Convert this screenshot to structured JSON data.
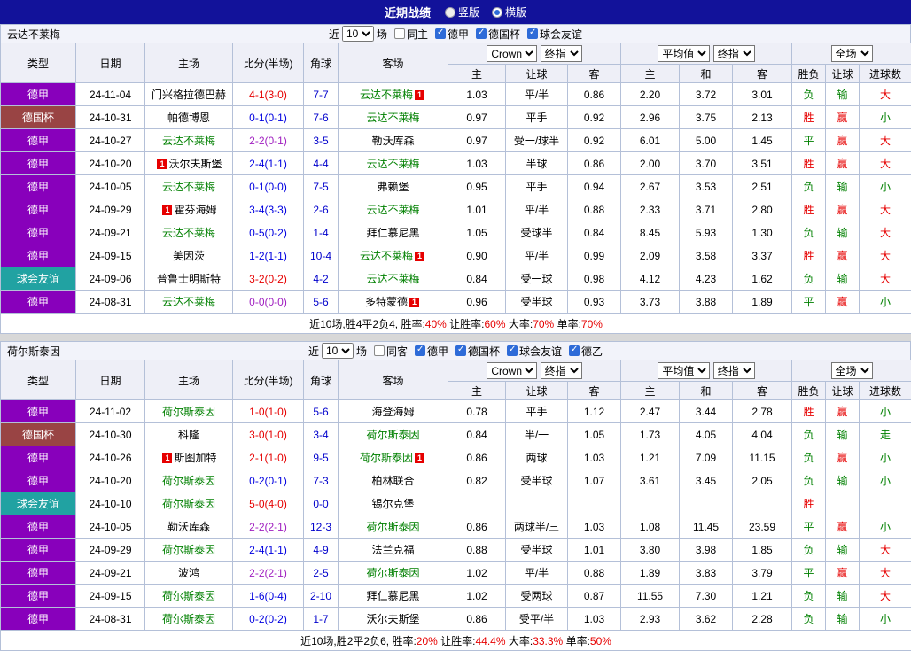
{
  "topbar": {
    "title": "近期战绩",
    "layout_options": [
      {
        "label": "竖版",
        "selected": false
      },
      {
        "label": "横版",
        "selected": true
      }
    ]
  },
  "table_header": {
    "cols": [
      "类型",
      "日期",
      "主场",
      "比分(半场)",
      "角球",
      "客场"
    ],
    "bookmaker_select": "Crown",
    "final_select": "终指",
    "average_select": "平均值",
    "scope_select": "全场",
    "handicap_cols": [
      "主",
      "让球",
      "客"
    ],
    "average_cols": [
      "主",
      "和",
      "客"
    ],
    "result_cols": [
      "胜负",
      "让球",
      "进球数"
    ]
  },
  "sections": [
    {
      "team": "云达不莱梅",
      "filters": {
        "near_label": "近",
        "count": "10",
        "games_label": "场",
        "checkboxes": [
          {
            "label": "同主",
            "checked": false
          },
          {
            "label": "德甲",
            "checked": true
          },
          {
            "label": "德国杯",
            "checked": true
          },
          {
            "label": "球会友谊",
            "checked": true
          }
        ]
      },
      "rows": [
        {
          "league": "德甲",
          "date": "24-11-04",
          "home": "门兴格拉德巴赫",
          "home_focus": false,
          "home_card": false,
          "away": "云达不莱梅",
          "away_focus": true,
          "away_card": true,
          "score": "4-1(3-0)",
          "score_result": "home_win",
          "corners": "7-7",
          "odds": [
            "1.03",
            "平/半",
            "0.86",
            "2.20",
            "3.72",
            "3.01"
          ],
          "results": [
            "负",
            "输",
            "大"
          ]
        },
        {
          "league": "德国杯",
          "date": "24-10-31",
          "home": "帕德博恩",
          "home_focus": false,
          "home_card": false,
          "away": "云达不莱梅",
          "away_focus": true,
          "away_card": false,
          "score": "0-1(0-1)",
          "score_result": "away_win",
          "corners": "7-6",
          "odds": [
            "0.97",
            "平手",
            "0.92",
            "2.96",
            "3.75",
            "2.13"
          ],
          "results": [
            "胜",
            "赢",
            "小"
          ]
        },
        {
          "league": "德甲",
          "date": "24-10-27",
          "home": "云达不莱梅",
          "home_focus": true,
          "home_card": false,
          "away": "勒沃库森",
          "away_focus": false,
          "away_card": false,
          "score": "2-2(0-1)",
          "score_result": "draw",
          "corners": "3-5",
          "odds": [
            "0.97",
            "受一/球半",
            "0.92",
            "6.01",
            "5.00",
            "1.45"
          ],
          "results": [
            "平",
            "赢",
            "大"
          ]
        },
        {
          "league": "德甲",
          "date": "24-10-20",
          "home": "沃尔夫斯堡",
          "home_focus": false,
          "home_card": true,
          "away": "云达不莱梅",
          "away_focus": true,
          "away_card": false,
          "score": "2-4(1-1)",
          "score_result": "away_win",
          "corners": "4-4",
          "odds": [
            "1.03",
            "半球",
            "0.86",
            "2.00",
            "3.70",
            "3.51"
          ],
          "results": [
            "胜",
            "赢",
            "大"
          ]
        },
        {
          "league": "德甲",
          "date": "24-10-05",
          "home": "云达不莱梅",
          "home_focus": true,
          "home_card": false,
          "away": "弗赖堡",
          "away_focus": false,
          "away_card": false,
          "score": "0-1(0-0)",
          "score_result": "away_win",
          "corners": "7-5",
          "odds": [
            "0.95",
            "平手",
            "0.94",
            "2.67",
            "3.53",
            "2.51"
          ],
          "results": [
            "负",
            "输",
            "小"
          ]
        },
        {
          "league": "德甲",
          "date": "24-09-29",
          "home": "霍芬海姆",
          "home_focus": false,
          "home_card": true,
          "away": "云达不莱梅",
          "away_focus": true,
          "away_card": false,
          "score": "3-4(3-3)",
          "score_result": "away_win",
          "corners": "2-6",
          "odds": [
            "1.01",
            "平/半",
            "0.88",
            "2.33",
            "3.71",
            "2.80"
          ],
          "results": [
            "胜",
            "赢",
            "大"
          ]
        },
        {
          "league": "德甲",
          "date": "24-09-21",
          "home": "云达不莱梅",
          "home_focus": true,
          "home_card": false,
          "away": "拜仁慕尼黑",
          "away_focus": false,
          "away_card": false,
          "score": "0-5(0-2)",
          "score_result": "away_win",
          "corners": "1-4",
          "odds": [
            "1.05",
            "受球半",
            "0.84",
            "8.45",
            "5.93",
            "1.30"
          ],
          "results": [
            "负",
            "输",
            "大"
          ]
        },
        {
          "league": "德甲",
          "date": "24-09-15",
          "home": "美因茨",
          "home_focus": false,
          "home_card": false,
          "away": "云达不莱梅",
          "away_focus": true,
          "away_card": true,
          "score": "1-2(1-1)",
          "score_result": "away_win",
          "corners": "10-4",
          "odds": [
            "0.90",
            "平/半",
            "0.99",
            "2.09",
            "3.58",
            "3.37"
          ],
          "results": [
            "胜",
            "赢",
            "大"
          ]
        },
        {
          "league": "球会友谊",
          "date": "24-09-06",
          "home": "普鲁士明斯特",
          "home_focus": false,
          "home_card": false,
          "away": "云达不莱梅",
          "away_focus": true,
          "away_card": false,
          "score": "3-2(0-2)",
          "score_result": "home_win",
          "corners": "4-2",
          "odds": [
            "0.84",
            "受一球",
            "0.98",
            "4.12",
            "4.23",
            "1.62"
          ],
          "results": [
            "负",
            "输",
            "大"
          ]
        },
        {
          "league": "德甲",
          "date": "24-08-31",
          "home": "云达不莱梅",
          "home_focus": true,
          "home_card": false,
          "away": "多特蒙德",
          "away_focus": false,
          "away_card": true,
          "score": "0-0(0-0)",
          "score_result": "draw",
          "corners": "5-6",
          "odds": [
            "0.96",
            "受半球",
            "0.93",
            "3.73",
            "3.88",
            "1.89"
          ],
          "results": [
            "平",
            "赢",
            "小"
          ]
        }
      ],
      "summary": [
        {
          "text": "近10场,胜4平2负4, 胜率:",
          "highlight": false
        },
        {
          "text": "40%",
          "highlight": true
        },
        {
          "text": " 让胜率:",
          "highlight": false
        },
        {
          "text": "60%",
          "highlight": true
        },
        {
          "text": " 大率:",
          "highlight": false
        },
        {
          "text": "70%",
          "highlight": true
        },
        {
          "text": " 单率:",
          "highlight": false
        },
        {
          "text": "70%",
          "highlight": true
        }
      ]
    },
    {
      "team": "荷尔斯泰因",
      "filters": {
        "near_label": "近",
        "count": "10",
        "games_label": "场",
        "checkboxes": [
          {
            "label": "同客",
            "checked": false
          },
          {
            "label": "德甲",
            "checked": true
          },
          {
            "label": "德国杯",
            "checked": true
          },
          {
            "label": "球会友谊",
            "checked": true
          },
          {
            "label": "德乙",
            "checked": true
          }
        ]
      },
      "rows": [
        {
          "league": "德甲",
          "date": "24-11-02",
          "home": "荷尔斯泰因",
          "home_focus": true,
          "home_card": false,
          "away": "海登海姆",
          "away_focus": false,
          "away_card": false,
          "score": "1-0(1-0)",
          "score_result": "home_win",
          "corners": "5-6",
          "odds": [
            "0.78",
            "平手",
            "1.12",
            "2.47",
            "3.44",
            "2.78"
          ],
          "results": [
            "胜",
            "赢",
            "小"
          ]
        },
        {
          "league": "德国杯",
          "date": "24-10-30",
          "home": "科隆",
          "home_focus": false,
          "home_card": false,
          "away": "荷尔斯泰因",
          "away_focus": true,
          "away_card": false,
          "score": "3-0(1-0)",
          "score_result": "home_win",
          "corners": "3-4",
          "odds": [
            "0.84",
            "半/一",
            "1.05",
            "1.73",
            "4.05",
            "4.04"
          ],
          "results": [
            "负",
            "输",
            "走"
          ]
        },
        {
          "league": "德甲",
          "date": "24-10-26",
          "home": "斯图加特",
          "home_focus": false,
          "home_card": true,
          "away": "荷尔斯泰因",
          "away_focus": true,
          "away_card": true,
          "score": "2-1(1-0)",
          "score_result": "home_win",
          "corners": "9-5",
          "odds": [
            "0.86",
            "两球",
            "1.03",
            "1.21",
            "7.09",
            "11.15"
          ],
          "results": [
            "负",
            "赢",
            "小"
          ]
        },
        {
          "league": "德甲",
          "date": "24-10-20",
          "home": "荷尔斯泰因",
          "home_focus": true,
          "home_card": false,
          "away": "柏林联合",
          "away_focus": false,
          "away_card": false,
          "score": "0-2(0-1)",
          "score_result": "away_win",
          "corners": "7-3",
          "odds": [
            "0.82",
            "受半球",
            "1.07",
            "3.61",
            "3.45",
            "2.05"
          ],
          "results": [
            "负",
            "输",
            "小"
          ]
        },
        {
          "league": "球会友谊",
          "date": "24-10-10",
          "home": "荷尔斯泰因",
          "home_focus": true,
          "home_card": false,
          "away": "锡尔克堡",
          "away_focus": false,
          "away_card": false,
          "score": "5-0(4-0)",
          "score_result": "home_win",
          "corners": "0-0",
          "odds": [
            "",
            "",
            "",
            "",
            "",
            ""
          ],
          "results": [
            "胜",
            "",
            ""
          ]
        },
        {
          "league": "德甲",
          "date": "24-10-05",
          "home": "勒沃库森",
          "home_focus": false,
          "home_card": false,
          "away": "荷尔斯泰因",
          "away_focus": true,
          "away_card": false,
          "score": "2-2(2-1)",
          "score_result": "draw",
          "corners": "12-3",
          "odds": [
            "0.86",
            "两球半/三",
            "1.03",
            "1.08",
            "11.45",
            "23.59"
          ],
          "results": [
            "平",
            "赢",
            "小"
          ]
        },
        {
          "league": "德甲",
          "date": "24-09-29",
          "home": "荷尔斯泰因",
          "home_focus": true,
          "home_card": false,
          "away": "法兰克福",
          "away_focus": false,
          "away_card": false,
          "score": "2-4(1-1)",
          "score_result": "away_win",
          "corners": "4-9",
          "odds": [
            "0.88",
            "受半球",
            "1.01",
            "3.80",
            "3.98",
            "1.85"
          ],
          "results": [
            "负",
            "输",
            "大"
          ]
        },
        {
          "league": "德甲",
          "date": "24-09-21",
          "home": "波鸿",
          "home_focus": false,
          "home_card": false,
          "away": "荷尔斯泰因",
          "away_focus": true,
          "away_card": false,
          "score": "2-2(2-1)",
          "score_result": "draw",
          "corners": "2-5",
          "odds": [
            "1.02",
            "平/半",
            "0.88",
            "1.89",
            "3.83",
            "3.79"
          ],
          "results": [
            "平",
            "赢",
            "大"
          ]
        },
        {
          "league": "德甲",
          "date": "24-09-15",
          "home": "荷尔斯泰因",
          "home_focus": true,
          "home_card": false,
          "away": "拜仁慕尼黑",
          "away_focus": false,
          "away_card": false,
          "score": "1-6(0-4)",
          "score_result": "away_win",
          "corners": "2-10",
          "odds": [
            "1.02",
            "受两球",
            "0.87",
            "11.55",
            "7.30",
            "1.21"
          ],
          "results": [
            "负",
            "输",
            "大"
          ]
        },
        {
          "league": "德甲",
          "date": "24-08-31",
          "home": "荷尔斯泰因",
          "home_focus": true,
          "home_card": false,
          "away": "沃尔夫斯堡",
          "away_focus": false,
          "away_card": false,
          "score": "0-2(0-2)",
          "score_result": "away_win",
          "corners": "1-7",
          "odds": [
            "0.86",
            "受平/半",
            "1.03",
            "2.93",
            "3.62",
            "2.28"
          ],
          "results": [
            "负",
            "输",
            "小"
          ]
        }
      ],
      "summary": [
        {
          "text": "近10场,胜2平2负6, 胜率:",
          "highlight": false
        },
        {
          "text": "20%",
          "highlight": true
        },
        {
          "text": " 让胜率:",
          "highlight": false
        },
        {
          "text": "44.4%",
          "highlight": true
        },
        {
          "text": " 大率:",
          "highlight": false
        },
        {
          "text": "33.3%",
          "highlight": true
        },
        {
          "text": " 单率:",
          "highlight": false
        },
        {
          "text": "50%",
          "highlight": true
        }
      ]
    }
  ],
  "colors": {
    "topbar_bg": "#12129A",
    "league_bundesliga": "#8800BB",
    "league_cup": "#994444",
    "league_friendly": "#21A2A2",
    "focus_team": "#008000",
    "score_home_win": "#E60000",
    "score_away_win": "#0000E0",
    "score_draw": "#A020C0",
    "corner_text": "#0000CC",
    "result_positive": "#E60000",
    "result_neutral": "#008000",
    "summary_highlight": "#E60000",
    "table_border": "#B4C0D8",
    "header_bg": "#EEEFF7",
    "section_header_bg": "#F2F3FA",
    "checkbox_fill": "#2E6BD8",
    "radio_dot": "#2E6BD8",
    "red_card": "#E60000"
  }
}
